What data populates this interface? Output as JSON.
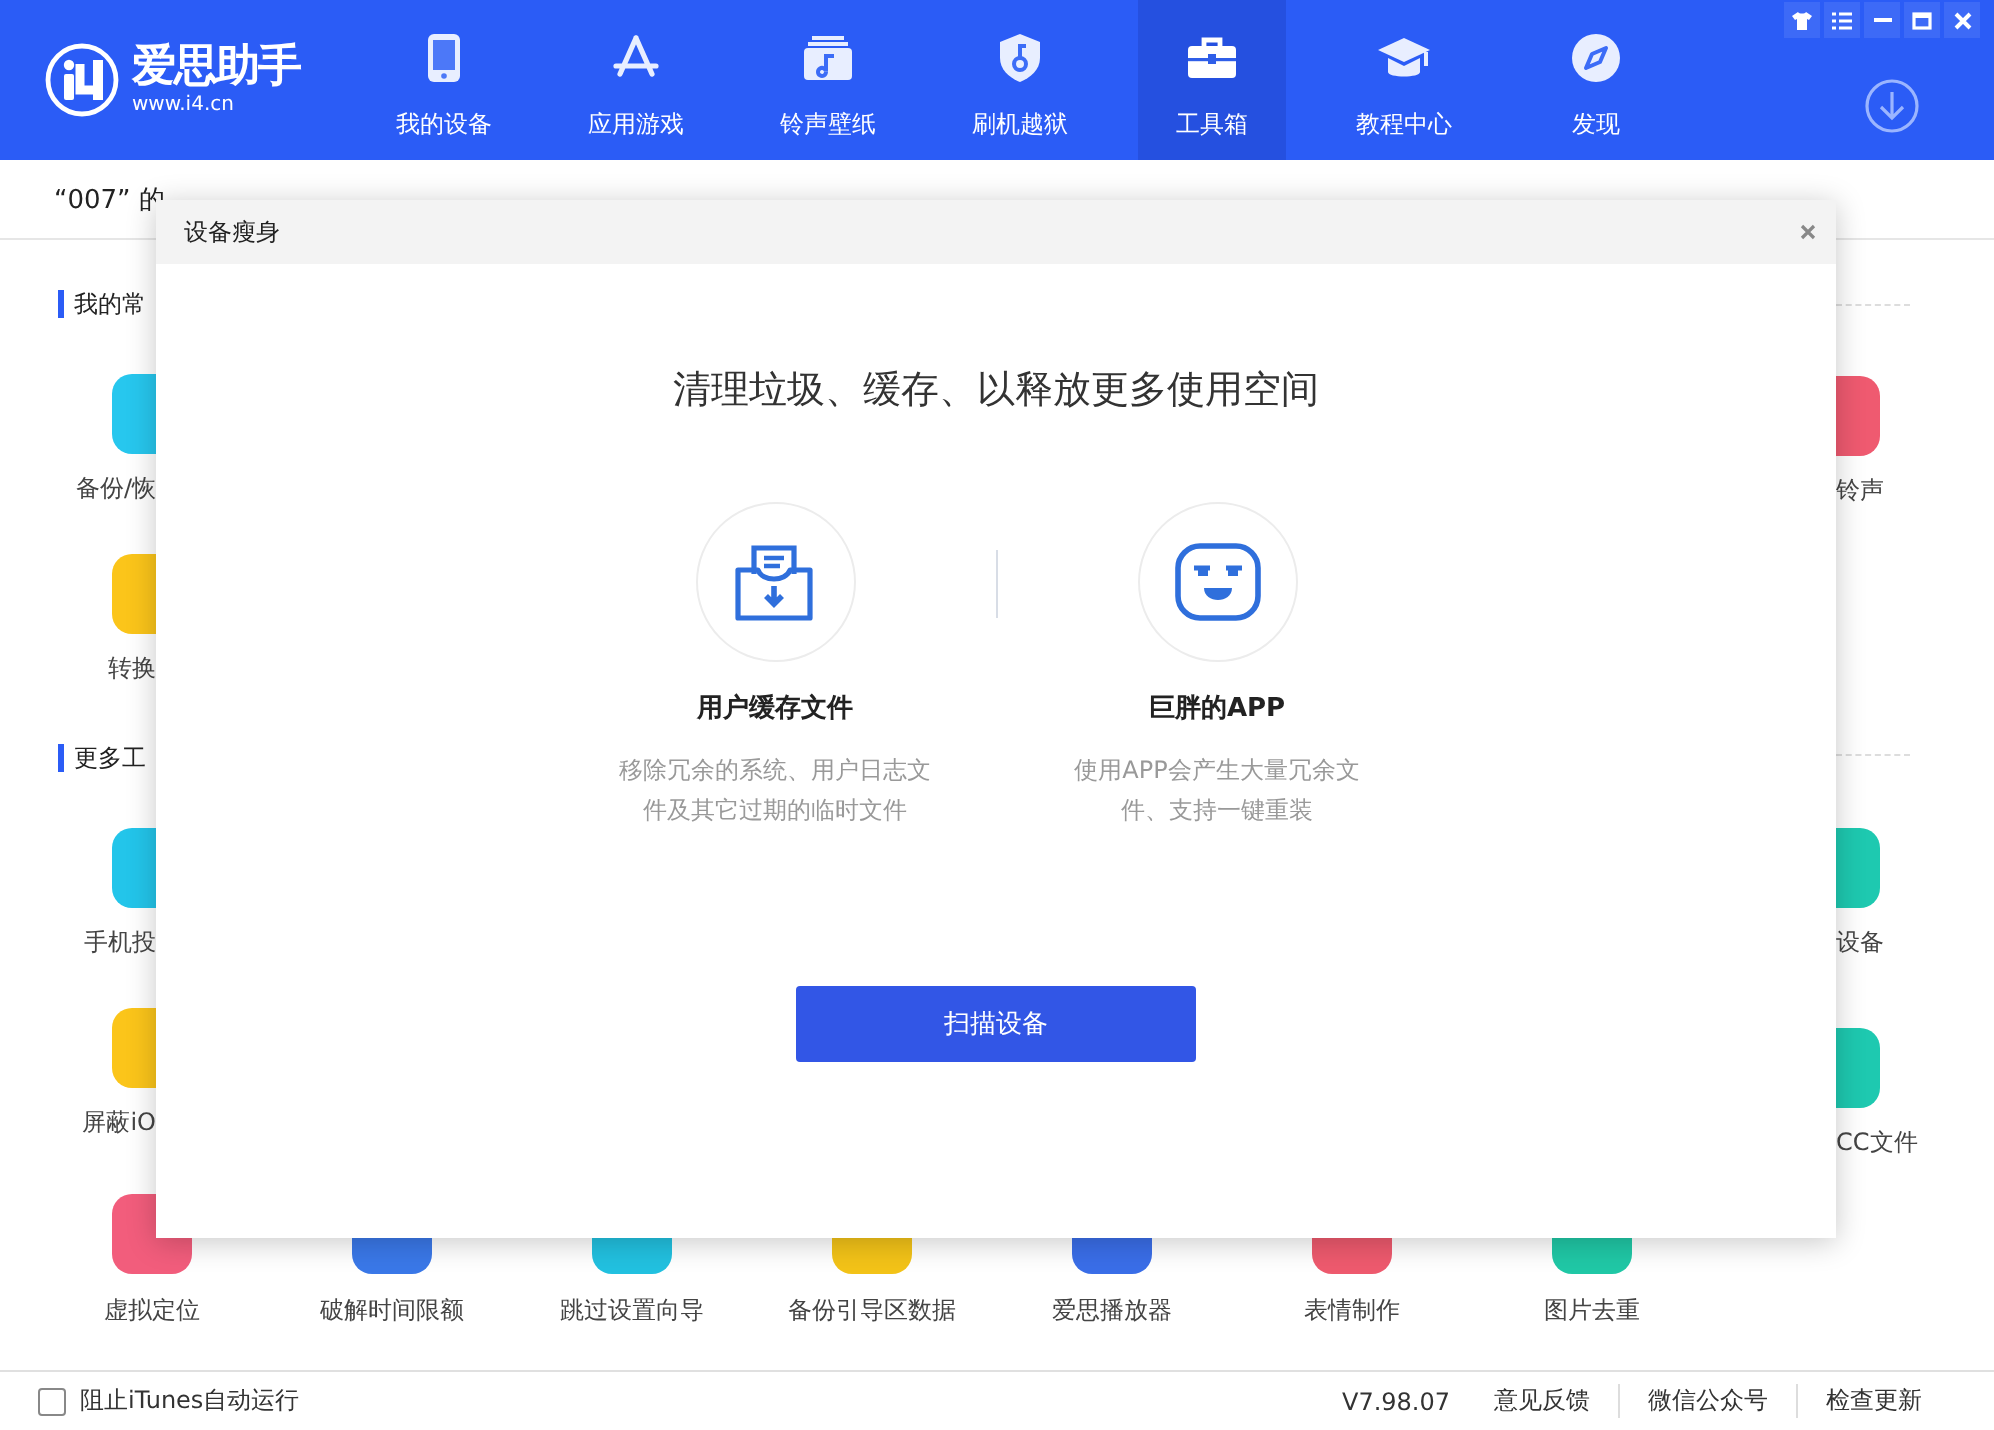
{
  "app": {
    "name": "爱思助手",
    "url": "www.i4.cn"
  },
  "nav": [
    {
      "label": "我的设备",
      "selected": false
    },
    {
      "label": "应用游戏",
      "selected": false
    },
    {
      "label": "铃声壁纸",
      "selected": false
    },
    {
      "label": "刷机越狱",
      "selected": false
    },
    {
      "label": "工具箱",
      "selected": true
    },
    {
      "label": "教程中心",
      "selected": false
    },
    {
      "label": "发现",
      "selected": false
    }
  ],
  "device_bar": {
    "device_name": "“007” 的"
  },
  "left_sections": [
    {
      "title": "我的常",
      "tools": [
        "备份/恢",
        "转换"
      ]
    },
    {
      "title": "更多工",
      "tools": [
        "手机投",
        "屏蔽iO"
      ]
    }
  ],
  "right_tools": [
    "铃声",
    "设备",
    "CC文件"
  ],
  "bottom_tools": [
    "虚拟定位",
    "破解时间限额",
    "跳过设置向导",
    "备份引导区数据",
    "爱思播放器",
    "表情制作",
    "图片去重"
  ],
  "dialog": {
    "title": "设备瘦身",
    "heading": "清理垃圾、缓存、以释放更多使用空间",
    "features": [
      {
        "title": "用户缓存文件",
        "description": "移除冗余的系统、用户日志文件及其它过期的临时文件"
      },
      {
        "title": "巨胖的APP",
        "description": "使用APP会产生大量冗余文件、支持一键重装"
      }
    ],
    "button": "扫描设备"
  },
  "footer": {
    "checkbox": {
      "label": "阻止iTunes自动运行",
      "checked": false
    },
    "version": "V7.98.07",
    "links": [
      "意见反馈",
      "微信公众号",
      "检查更新"
    ]
  }
}
